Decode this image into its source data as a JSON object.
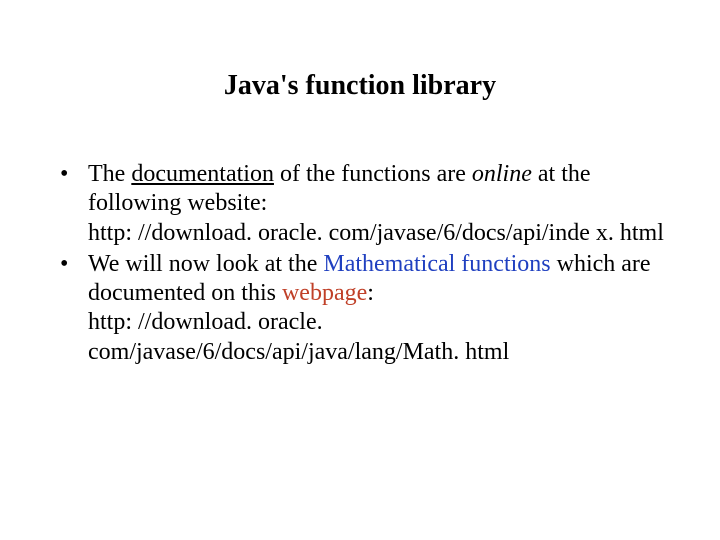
{
  "title": "Java's function library",
  "bullets": [
    {
      "pre1": "The ",
      "doc": "documentation",
      "mid1": " of the functions are ",
      "online": "online",
      "post1": " at the following website:",
      "url": "http: //download. oracle. com/javase/6/docs/api/inde x. html"
    },
    {
      "pre2": "We will now look at the ",
      "math": "Mathematical functions",
      "mid2": " which are documented on this ",
      "webpage": "webpage",
      "colon": ":",
      "url": "http: //download. oracle. com/javase/6/docs/api/java/lang/Math. html"
    }
  ]
}
